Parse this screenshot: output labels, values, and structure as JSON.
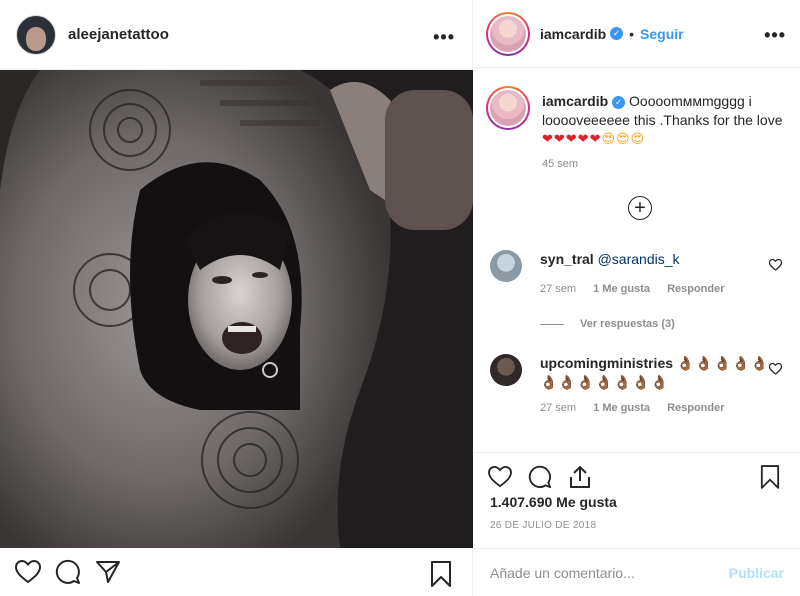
{
  "post_author": {
    "username": "aleejanetattoo",
    "more_label": "•••"
  },
  "photo": {
    "description_icon": "tattoo-photo"
  },
  "right_header": {
    "username": "iamcardib",
    "separator": "•",
    "follow_label": "Seguir",
    "more_label": "•••"
  },
  "caption": {
    "username": "iamcardib",
    "text": "Ooooomммmgggg i looooveeeeee this .Thanks for the love",
    "emojis_hearts": "❤❤❤❤❤",
    "emojis_faces": "😍😍😍",
    "time": "45 sem"
  },
  "load_more_label": "+",
  "comments": [
    {
      "username": "syn_tral",
      "mention": "@sarandis_k",
      "time": "27 sem",
      "likes": "1 Me gusta",
      "reply": "Responder"
    },
    {
      "username": "upcomingministries",
      "emojis_1": "👌🏾👌🏾👌🏾👌🏾👌🏾",
      "emojis_2": "👌🏾👌🏾👌🏾👌🏾👌🏾👌🏾👌🏾",
      "time": "27 sem",
      "likes": "1 Me gusta",
      "reply": "Responder"
    }
  ],
  "view_replies": "Ver respuestas (3)",
  "likes_count": "1.407.690 Me gusta",
  "date": "26 DE JULIO DE 2018",
  "add_comment": {
    "placeholder": "Añade un comentario...",
    "publish": "Publicar"
  },
  "colors": {
    "link": "#3897f0",
    "muted": "#8e8e8e",
    "publish_disabled": "#b2dffc"
  }
}
